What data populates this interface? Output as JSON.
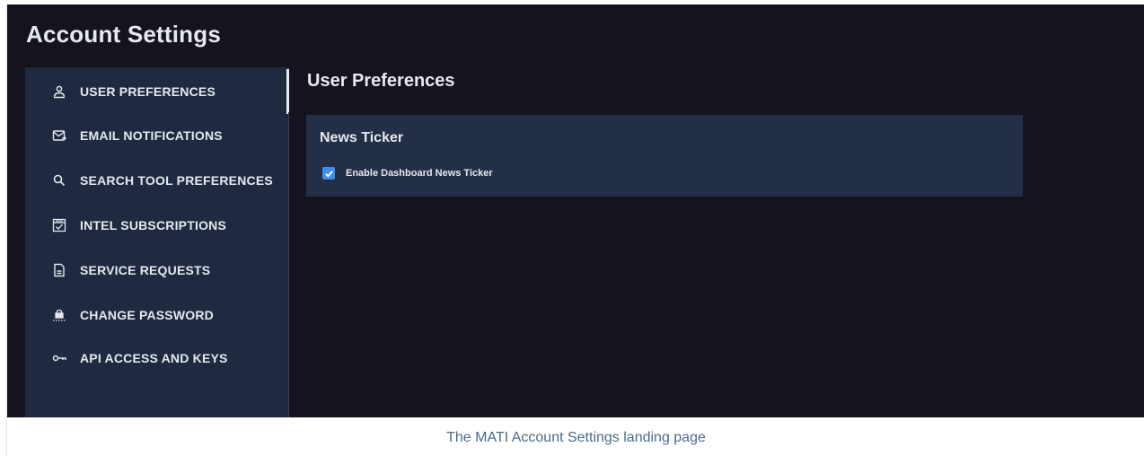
{
  "app": {
    "title": "Account Settings"
  },
  "sidebar": {
    "items": [
      {
        "label": "USER PREFERENCES",
        "icon": "user-icon",
        "active": true
      },
      {
        "label": "EMAIL NOTIFICATIONS",
        "icon": "mail-notification-icon",
        "active": false
      },
      {
        "label": "SEARCH TOOL PREFERENCES",
        "icon": "search-icon",
        "active": false
      },
      {
        "label": "INTEL SUBSCRIPTIONS",
        "icon": "subscription-icon",
        "active": false
      },
      {
        "label": "SERVICE REQUESTS",
        "icon": "document-icon",
        "active": false
      },
      {
        "label": "CHANGE PASSWORD",
        "icon": "password-lock-icon",
        "active": false
      },
      {
        "label": "API ACCESS AND KEYS",
        "icon": "key-icon",
        "active": false
      }
    ]
  },
  "main": {
    "title": "User Preferences",
    "panel": {
      "title": "News Ticker",
      "checkbox": {
        "label": "Enable Dashboard News Ticker",
        "checked": true
      }
    }
  },
  "caption": "The MATI Account Settings landing page",
  "colors": {
    "background": "#15141e",
    "sidebar": "#1f2a40",
    "panel": "#232e47",
    "accent": "#3d8ef0",
    "caption": "#4a6a8e"
  }
}
